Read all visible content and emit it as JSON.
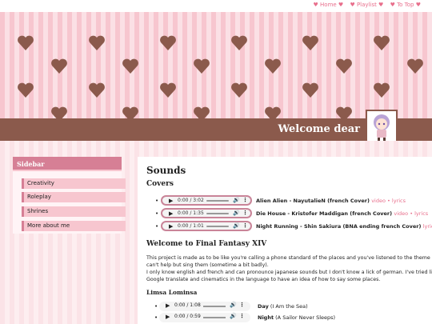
{
  "nav": {
    "links": [
      "♥ Home ♥",
      "♥ Playlist ♥",
      "♥ To Top ♥"
    ]
  },
  "header": {
    "welcome": "Welcome dear"
  },
  "sidebar": {
    "title": "Sidebar",
    "items": [
      "Creativity",
      "Roleplay",
      "Shrines",
      "More about me"
    ]
  },
  "main": {
    "title": "Sounds",
    "covers_heading": "Covers",
    "covers": [
      {
        "time": "0:00 / 3:02",
        "title": "Alien Alien - NayutalieN (french Cover)",
        "links": "video • lyrics"
      },
      {
        "time": "0:00 / 1:35",
        "title": "Die House - Kristofer Maddigan (french Cover)",
        "links": "video • lyrics"
      },
      {
        "time": "0:00 / 1:01",
        "title": "Night Running - Shin Sakiura (BNA ending french Cover)",
        "links": "lyrics"
      }
    ],
    "ff_heading": "Welcome to Final Fantasy XIV",
    "para1_line1": "This project is made as to be like you're calling a phone standard of the places and you've listened to the theme so much y",
    "para1_line2": "can't help but sing them (sometime a bit badly).",
    "para2_line1": "I only know english and french and can pronounce japanese sounds but I don't know a lick of german. I've tried listening to",
    "para2_line2": "Google translate and cinematics in the language to have an idea of how to say some places.",
    "limsa_heading": "Limsa Lominsa",
    "limsa_tracks": [
      {
        "time": "0:00 / 1:08",
        "name": "Day",
        "sub": "(I Am the Sea)"
      },
      {
        "time": "0:00 / 0:59",
        "name": "Night",
        "sub": "(A Sailor Never Sleeps)"
      }
    ]
  },
  "colors": {
    "accent_pink": "#e86f8c",
    "brown": "#8b5a4c",
    "sidebar_header": "#d67f95"
  }
}
